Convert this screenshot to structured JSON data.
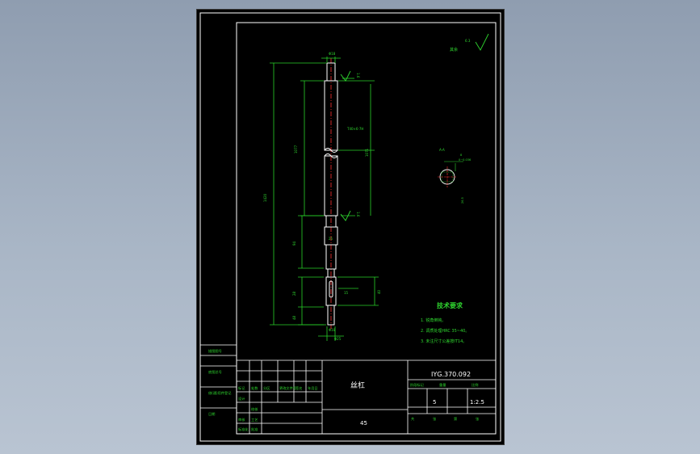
{
  "drawing": {
    "number": "IYG.370.092",
    "part_name": "丝杠",
    "material": "45",
    "scale_label": "比例",
    "scale": "1:2.5",
    "quantity_label": "数量",
    "quantity": "1",
    "weight_label": "重量",
    "stage_label": "阶段标记",
    "qty_value": "5",
    "sheet_row": [
      "共",
      "张",
      "第",
      "张"
    ]
  },
  "tech_requirements": {
    "title": "技术要求",
    "items": [
      "1. 锐角倒钝。",
      "2. 调质处理HRC 35~40。",
      "3. 未注尺寸公差按IT14。"
    ]
  },
  "roughness": {
    "label": "其余",
    "value": "6.3"
  },
  "section": {
    "label": "A-A",
    "width_dim": "8",
    "tol": "0~0.036",
    "depth": "26.5"
  },
  "dims": {
    "total_length": "1420",
    "top_dia": "Φ18",
    "thread": "T40×6-7H",
    "upper_len": "1077",
    "lower_len": "94",
    "key_len": "28",
    "bottom_len": "48",
    "bottom_dia1": "Φ18",
    "bottom_dia2": "Φ25",
    "r1": "1.6",
    "r2": "1.6",
    "mid_a": "1071",
    "mid_b": "25",
    "k1": "15",
    "k2": "40"
  },
  "title_block": {
    "row_labels": [
      "标记",
      "处数",
      "分区",
      "更改文件号",
      "签名",
      "年月日"
    ],
    "left_labels": [
      "描图图号",
      "底图总号",
      "借(通)用件登记",
      "日期"
    ],
    "sign_labels": [
      "设计",
      "校核",
      "审核",
      "工艺",
      "标准化",
      "批准"
    ]
  }
}
